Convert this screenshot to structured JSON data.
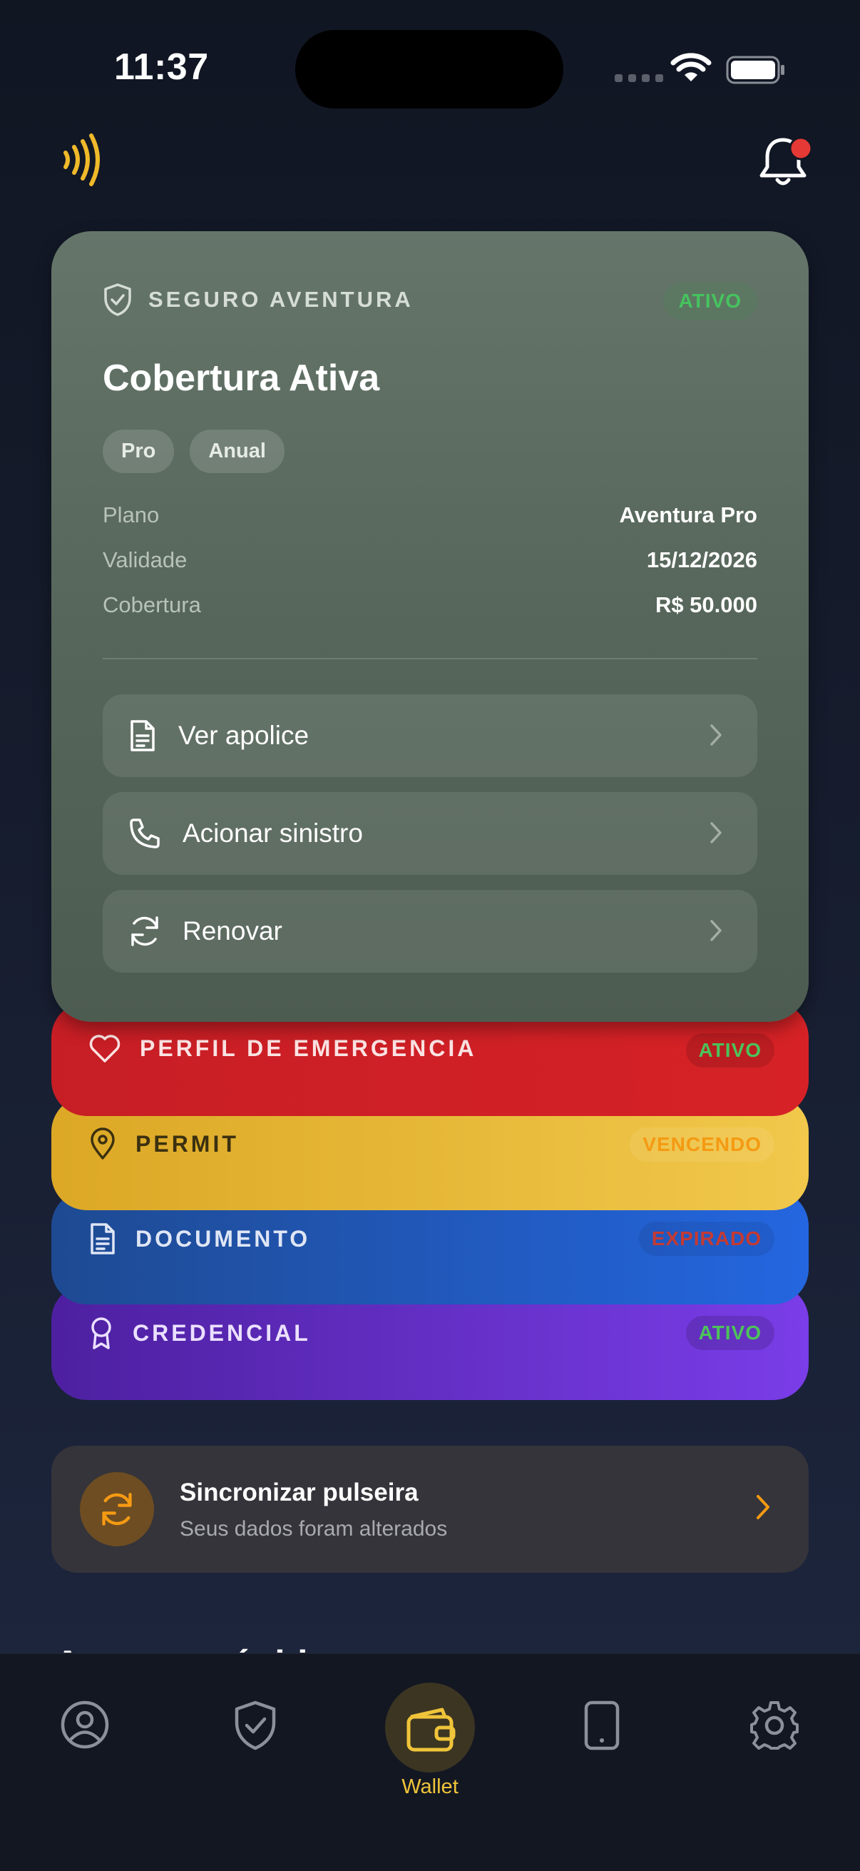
{
  "status_bar": {
    "time": "11:37"
  },
  "insurance_card": {
    "label": "SEGURO AVENTURA",
    "status": "ATIVO",
    "title": "Cobertura Ativa",
    "tags": [
      "Pro",
      "Anual"
    ],
    "details": [
      {
        "key": "Plano",
        "value": "Aventura Pro"
      },
      {
        "key": "Validade",
        "value": "15/12/2026"
      },
      {
        "key": "Cobertura",
        "value": "R$ 50.000"
      }
    ],
    "actions": [
      {
        "label": "Ver apolice",
        "icon": "document-icon"
      },
      {
        "label": "Acionar sinistro",
        "icon": "phone-icon"
      },
      {
        "label": "Renovar",
        "icon": "refresh-icon"
      }
    ]
  },
  "stacked_cards": [
    {
      "label": "PERFIL DE EMERGENCIA",
      "status": "ATIVO",
      "icon": "heart-icon",
      "status_color": "#4cc35a"
    },
    {
      "label": "PERMIT",
      "status": "VENCENDO",
      "icon": "location-pin-icon",
      "status_color": "#f59a13"
    },
    {
      "label": "DOCUMENTO",
      "status": "EXPIRADO",
      "icon": "document-icon",
      "status_color": "#c43a32"
    },
    {
      "label": "CREDENCIAL",
      "status": "ATIVO",
      "icon": "award-icon",
      "status_color": "#4cc35a"
    }
  ],
  "sync": {
    "title": "Sincronizar pulseira",
    "subtitle": "Seus dados foram alterados"
  },
  "section_peek": "Acessos rápidos",
  "bottom_nav": {
    "items": [
      "profile-icon",
      "shield-check-icon",
      "wallet-icon",
      "phone-device-icon",
      "gear-icon"
    ],
    "active_label": "Wallet"
  },
  "colors": {
    "accent": "#f0c43a",
    "card_green": "#5b6b5f",
    "red": "#d12227",
    "yellow": "#ecc043",
    "blue": "#2356c0",
    "purple": "#6a30d0"
  }
}
